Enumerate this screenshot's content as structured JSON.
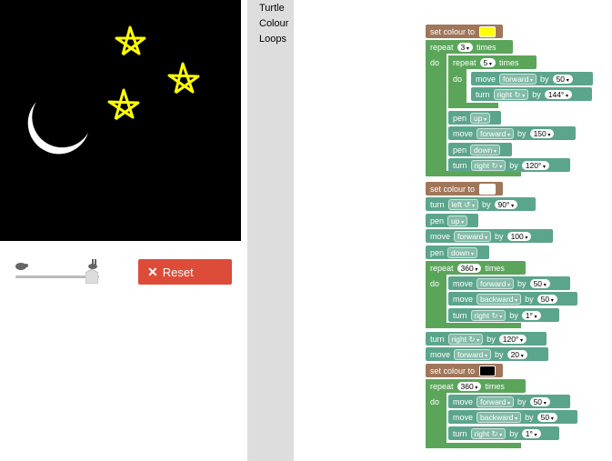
{
  "toolbox": {
    "categories": [
      "Turtle",
      "Colour",
      "Loops"
    ]
  },
  "controls": {
    "reset_label": "Reset"
  },
  "colors": {
    "yellow": "#ffff00",
    "white": "#ffffff",
    "black": "#000000"
  },
  "blocks": {
    "set_colour": "set colour to",
    "repeat": "repeat",
    "times": "times",
    "do": "do",
    "move": "move",
    "turn": "turn",
    "pen": "pen",
    "by": "by",
    "forward": "forward",
    "backward": "backward",
    "right": "right ↻",
    "left": "left ↺",
    "up": "up",
    "down": "down",
    "v3": "3",
    "v5": "5",
    "v50": "50",
    "v144": "144°",
    "v150": "150",
    "v120": "120°",
    "v90": "90°",
    "v100": "100",
    "v360": "360",
    "v1": "1°",
    "v20": "20"
  }
}
